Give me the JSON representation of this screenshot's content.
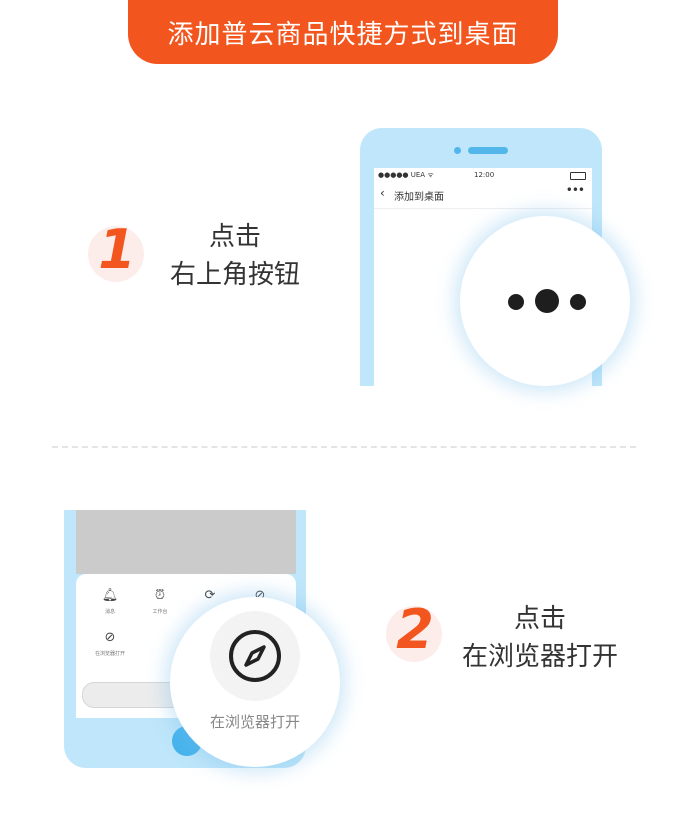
{
  "banner": {
    "title": "添加普云商品快捷方式到桌面"
  },
  "step1": {
    "number": "1",
    "line1": "点击",
    "line2": "右上角按钮",
    "phone": {
      "carrier": "●●●●● UEA ᯤ",
      "time": "12:00",
      "back_icon": "chevron-left",
      "nav_title": "添加到桌面",
      "more_icon": "•••"
    }
  },
  "step2": {
    "number": "2",
    "line1": "点击",
    "line2": "在浏览器打开",
    "sheet": {
      "items": [
        {
          "icon": "bell-icon",
          "glyph": "🔔︎",
          "label": "消息"
        },
        {
          "icon": "alarm-icon",
          "glyph": "⏰︎",
          "label": "工作台"
        },
        {
          "icon": "refresh-icon",
          "glyph": "⟳",
          "label": ""
        },
        {
          "icon": "compass-icon",
          "glyph": "⊘",
          "label": ""
        },
        {
          "icon": "compass-icon",
          "glyph": "⊘",
          "label": "在浏览器打开"
        }
      ]
    },
    "magnifier_label": "在浏览器打开"
  },
  "colors": {
    "accent": "#F2551D",
    "phone_body": "#BFE6FA",
    "phone_detail": "#52B6EA"
  }
}
